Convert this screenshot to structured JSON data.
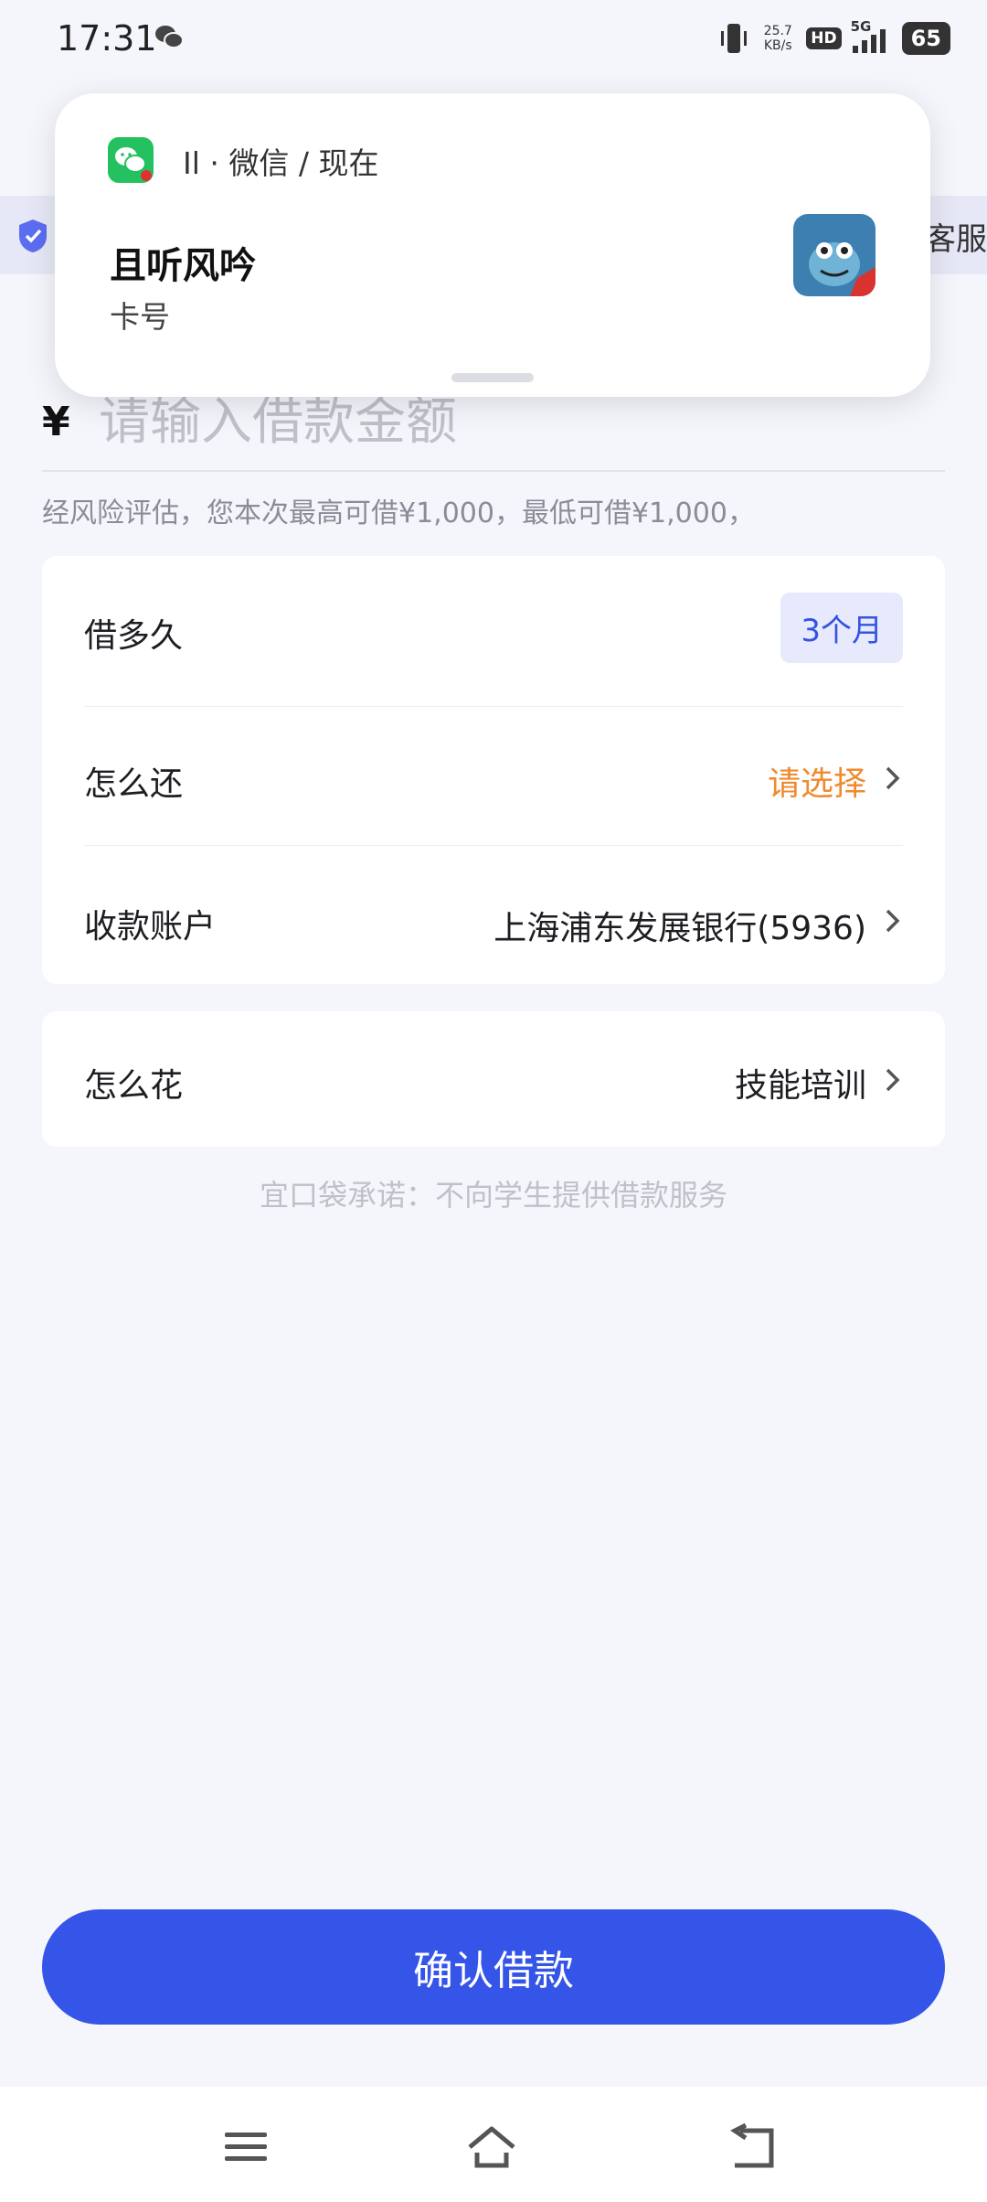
{
  "status_bar": {
    "time": "17:31",
    "net_speed": "25.7",
    "net_unit": "KB/s",
    "hd": "HD",
    "network": "5G",
    "battery": "65"
  },
  "banner": {
    "customer_service": "客服"
  },
  "amount": {
    "currency": "¥",
    "placeholder": "请输入借款金额",
    "limit_note": "经风险评估，您本次最高可借¥1,000，最低可借¥1,000，"
  },
  "options": {
    "term_label": "借多久",
    "term_value": "3个月",
    "repay_label": "怎么还",
    "repay_value": "请选择",
    "account_label": "收款账户",
    "account_value": "上海浦东发展银行(5936)",
    "usage_label": "怎么花",
    "usage_value": "技能培训"
  },
  "promise": "宜口袋承诺：不向学生提供借款服务",
  "confirm_button": "确认借款",
  "notification": {
    "header": "Il · 微信 / 现在",
    "title": "且听风吟",
    "body": "卡号"
  },
  "colors": {
    "primary": "#3554e8",
    "accent_orange": "#f08a2e",
    "wechat_green": "#23c160"
  }
}
